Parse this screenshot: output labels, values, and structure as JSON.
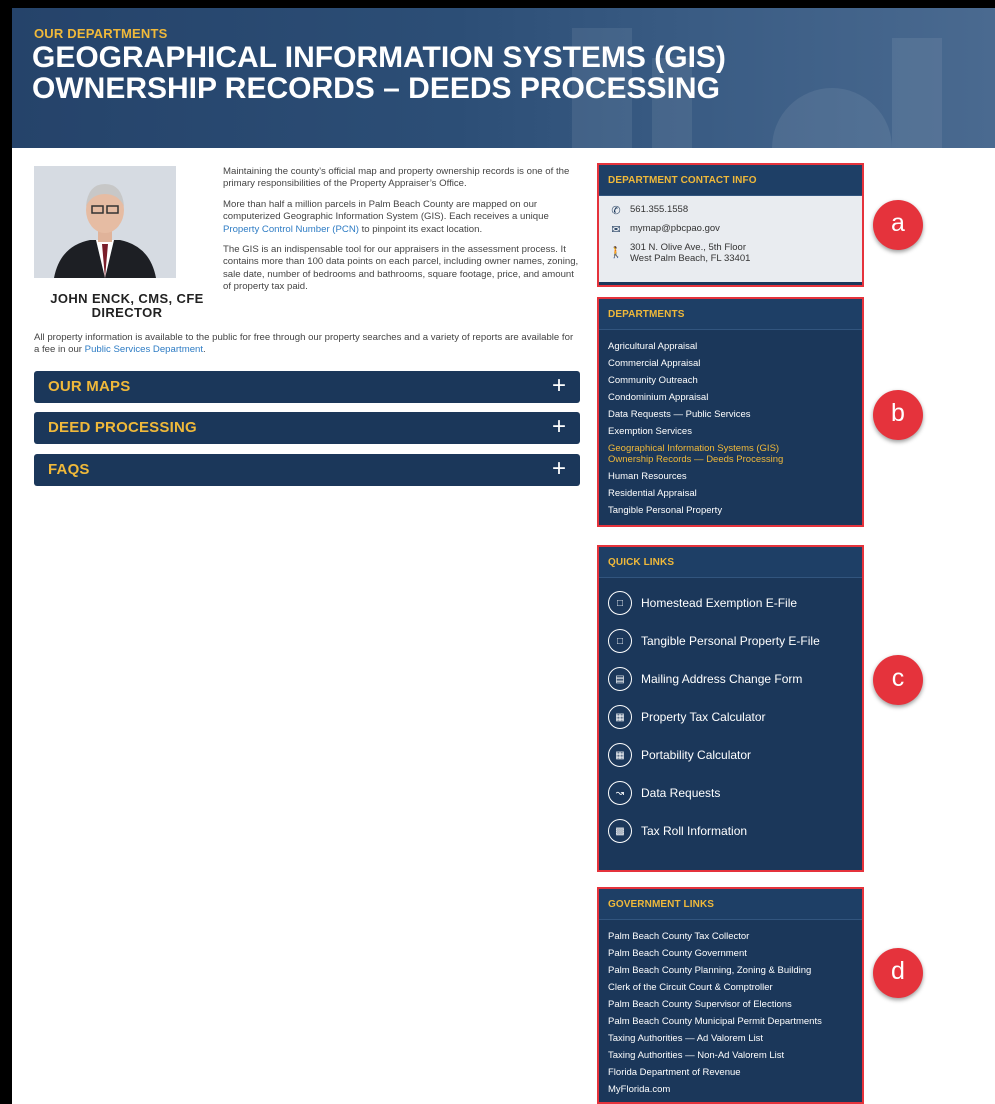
{
  "hero": {
    "eyebrow": "OUR DEPARTMENTS",
    "title_line1": "GEOGRAPHICAL INFORMATION SYSTEMS (GIS)",
    "title_line2": "OWNERSHIP RECORDS – DEEDS PROCESSING"
  },
  "director": {
    "name": "JOHN ENCK, CMS, CFE",
    "title": "DIRECTOR"
  },
  "intro": {
    "p1": "Maintaining the county’s official map and property ownership records is one of the primary responsibilities of the Property Appraiser’s Office.",
    "p2_before": "More than half a million parcels in Palm Beach County are mapped on our computerized Geographic Information System (GIS). Each receives a unique ",
    "p2_link": "Property Control Number (PCN)",
    "p2_after": " to pinpoint its exact location.",
    "p3": "The GIS is an indispensable tool for our appraisers in the assessment process. It contains more than 100 data points on each parcel, including owner names, zoning, sale date, number of bedrooms and bathrooms, square footage, price, and amount of property tax paid.",
    "p4_before": "All property information is available to the public for free through our property searches and a variety of reports are available for a fee in our ",
    "p4_link": "Public Services Department",
    "p4_after": "."
  },
  "accordions": [
    {
      "label": "OUR MAPS",
      "icon": "plus-icon"
    },
    {
      "label": "DEED PROCESSING",
      "icon": "plus-icon"
    },
    {
      "label": "FAQS",
      "icon": "plus-icon"
    }
  ],
  "contact": {
    "heading": "DEPARTMENT CONTACT INFO",
    "phone": "561.355.1558",
    "email": "mymap@pbcpao.gov",
    "address_line1": "301 N. Olive Ave., 5th Floor",
    "address_line2": "West Palm Beach, FL 33401"
  },
  "departments": {
    "heading": "DEPARTMENTS",
    "items": [
      "Agricultural Appraisal",
      "Commercial Appraisal",
      "Community Outreach",
      "Condominium Appraisal",
      "Data Requests — Public Services",
      "Exemption Services",
      "Human Resources",
      "Residential Appraisal",
      "Tangible Personal Property"
    ],
    "active_line1": "Geographical Information Systems (GIS)",
    "active_line2": "Ownership Records — Deeds Processing"
  },
  "quick_links": {
    "heading": "QUICK LINKS",
    "items": [
      {
        "label": "Homestead Exemption E-File",
        "icon": "laptop-icon"
      },
      {
        "label": "Tangible Personal Property E-File",
        "icon": "laptop-icon"
      },
      {
        "label": "Mailing Address Change Form",
        "icon": "address-card-icon"
      },
      {
        "label": "Property Tax Calculator",
        "icon": "calculator-icon"
      },
      {
        "label": "Portability Calculator",
        "icon": "calculator-icon"
      },
      {
        "label": "Data Requests",
        "icon": "chart-icon"
      },
      {
        "label": "Tax Roll Information",
        "icon": "document-icon"
      }
    ]
  },
  "government_links": {
    "heading": "GOVERNMENT LINKS",
    "items": [
      "Palm Beach County Tax Collector",
      "Palm Beach County Government",
      "Palm Beach County Planning, Zoning & Building",
      "Clerk of the Circuit Court & Comptroller",
      "Palm Beach County Supervisor of Elections",
      "Palm Beach County Municipal Permit Departments",
      "Taxing Authorities — Ad Valorem List",
      "Taxing Authorities — Non-Ad Valorem List",
      "Florida Department of Revenue",
      "MyFlorida.com"
    ]
  },
  "badges": {
    "a": "a",
    "b": "b",
    "c": "c",
    "d": "d"
  },
  "colors": {
    "navy": "#1b375a",
    "gold": "#f0b93a",
    "link_blue": "#2e7cc4",
    "annotation_red": "#e5333c"
  }
}
